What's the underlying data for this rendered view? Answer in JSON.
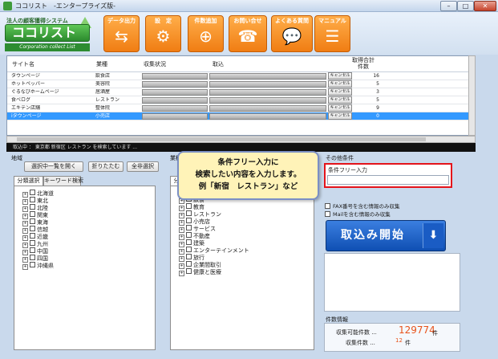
{
  "window": {
    "title": "ココリスト　-エンタープライズ版-",
    "controls": {
      "minimize": "–",
      "maximize": "□",
      "close": "✕"
    }
  },
  "logo": {
    "tagline": "法人の顧客獲得システム",
    "name": "ココリスト",
    "subtitle": "Corporation collect List"
  },
  "toolbar": {
    "buttons": [
      {
        "label": "データ出力",
        "icon": "⇆"
      },
      {
        "label": "設　定",
        "icon": "⚙"
      },
      {
        "label": "件数追加",
        "icon": "⊕"
      },
      {
        "label": "お問い合せ",
        "icon": "☎"
      },
      {
        "label": "よくある質問",
        "icon": "💬"
      },
      {
        "label": "マニュアル",
        "icon": "☰"
      }
    ]
  },
  "table": {
    "headers": {
      "site": "サイト名",
      "industry": "業種",
      "status": "収集状況",
      "progress": "取込",
      "count": "取得合計\n件数"
    },
    "rows": [
      {
        "site": "タウンページ",
        "industry": "飲食店",
        "cancel": "キャンセル",
        "count": "16"
      },
      {
        "site": "ホットペッパー",
        "industry": "美容院",
        "cancel": "キャンセル",
        "count": "5"
      },
      {
        "site": "ぐるなびホームページ",
        "industry": "居酒屋",
        "cancel": "キャンセル",
        "count": "3"
      },
      {
        "site": "食べログ",
        "industry": "レストラン",
        "cancel": "キャンセル",
        "count": "5"
      },
      {
        "site": "エキテン店舗",
        "industry": "整体院",
        "cancel": "キャンセル",
        "count": "9"
      },
      {
        "site": "iタウンページ",
        "industry": "小売店",
        "cancel": "キャンセル",
        "count": "0"
      }
    ]
  },
  "status_band": "取込中 ： 東京都 新宿区 レストラン を検索しています ...",
  "region": {
    "label": "地域",
    "buttons": {
      "open_list": "選択中一覧を開く",
      "collapse": "折りたたむ",
      "deselect_all": "全非選択"
    },
    "tabs": {
      "category": "分類選択",
      "keyword": "キーワード検索"
    },
    "items": [
      "北海道",
      "東北",
      "北陸",
      "関東",
      "東海",
      "信越",
      "近畿",
      "九州",
      "中国",
      "四国",
      "沖縄県"
    ]
  },
  "industry": {
    "label": "業種",
    "tab": "分",
    "items": [
      "飲食",
      "教育",
      "レストラン",
      "小売店",
      "サービス",
      "不動産",
      "建築",
      "エンターテインメント",
      "旅行",
      "企業間取引",
      "健康と医療"
    ]
  },
  "tooltip": {
    "line1": "条件フリー入力に",
    "line2": "検索したい内容を入力します。",
    "line3": "例「新宿　レストラン」など"
  },
  "other": {
    "label": "その他条件",
    "free_input_label": "条件フリー入力",
    "free_input_value": "",
    "fax_only": "FAX番号を含む情報のみ収集",
    "mail_only": "Mailを含む情報のみ収集",
    "start_button": "取込み開始",
    "start_icon": "⬇"
  },
  "stats": {
    "label": "件数情報",
    "collectable_label": "収集可能件数 ...",
    "collectable_value": "129774",
    "collectable_unit": "件",
    "collected_label": "収集件数 ...",
    "collected_value": "12",
    "collected_unit": "件"
  }
}
